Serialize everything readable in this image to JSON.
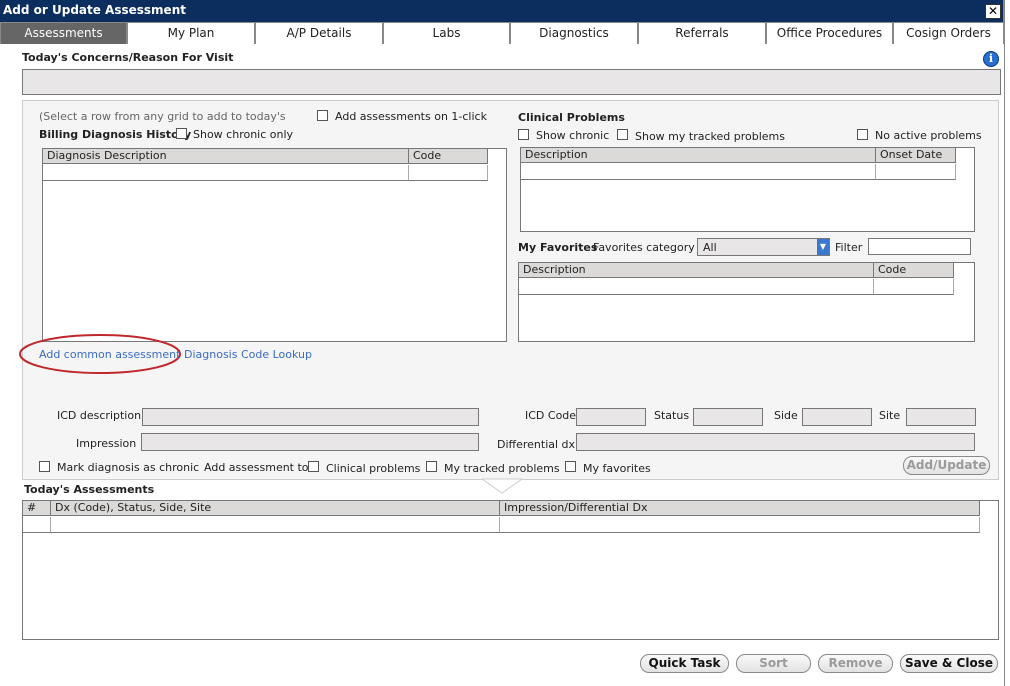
{
  "window": {
    "title": "Add or Update Assessment",
    "close_glyph": "✕"
  },
  "tabs": [
    {
      "label": "Assessments"
    },
    {
      "label": "My Plan"
    },
    {
      "label": "A/P Details"
    },
    {
      "label": "Labs"
    },
    {
      "label": "Diagnostics"
    },
    {
      "label": "Referrals"
    },
    {
      "label": "Office Procedures"
    },
    {
      "label": "Cosign Orders"
    }
  ],
  "concerns": {
    "label": "Today's Concerns/Reason For Visit",
    "value": ""
  },
  "left": {
    "hint": "(Select a row from any grid to add to today's",
    "add_on_click_label": "Add assessments on 1-click",
    "billing_title": "Billing Diagnosis History",
    "show_chronic_only": "Show chronic only",
    "grid": {
      "col1": "Diagnosis Description",
      "col2": "Code"
    },
    "add_common": "Add common assessment",
    "code_lookup": "Diagnosis Code Lookup"
  },
  "clinical": {
    "title": "Clinical Problems",
    "show_chronic": "Show chronic",
    "show_tracked": "Show my tracked problems",
    "no_active": "No active problems",
    "grid": {
      "col1": "Description",
      "col2": "Onset Date"
    }
  },
  "favorites": {
    "title": "My Favorites",
    "category_label": "Favorites category",
    "category_value": "All",
    "filter_label": "Filter",
    "filter_value": "",
    "grid": {
      "col1": "Description",
      "col2": "Code"
    }
  },
  "details": {
    "icd_description": "ICD description",
    "icd_code": "ICD Code",
    "status": "Status",
    "side": "Side",
    "site": "Site",
    "impression": "Impression",
    "differential": "Differential dx",
    "mark_chronic": "Mark diagnosis as chronic",
    "add_to": "Add assessment to",
    "clinical_problems": "Clinical problems",
    "my_tracked": "My tracked problems",
    "my_favorites": "My favorites",
    "add_update": "Add/Update"
  },
  "today": {
    "title": "Today's Assessments",
    "col_num": "#",
    "col_dx": "Dx (Code), Status, Side, Site",
    "col_imp": "Impression/Differential Dx"
  },
  "footer": {
    "quick_task": "Quick Task",
    "sort": "Sort",
    "remove": "Remove",
    "save_close": "Save & Close"
  },
  "colors": {
    "title_bar": "#0b2e5e",
    "active_tab": "#666666",
    "link": "#3a6cc2",
    "highlight_ring": "#c0282d"
  },
  "icons": {
    "info": "info-icon",
    "dropdown": "chevron-down-icon"
  }
}
